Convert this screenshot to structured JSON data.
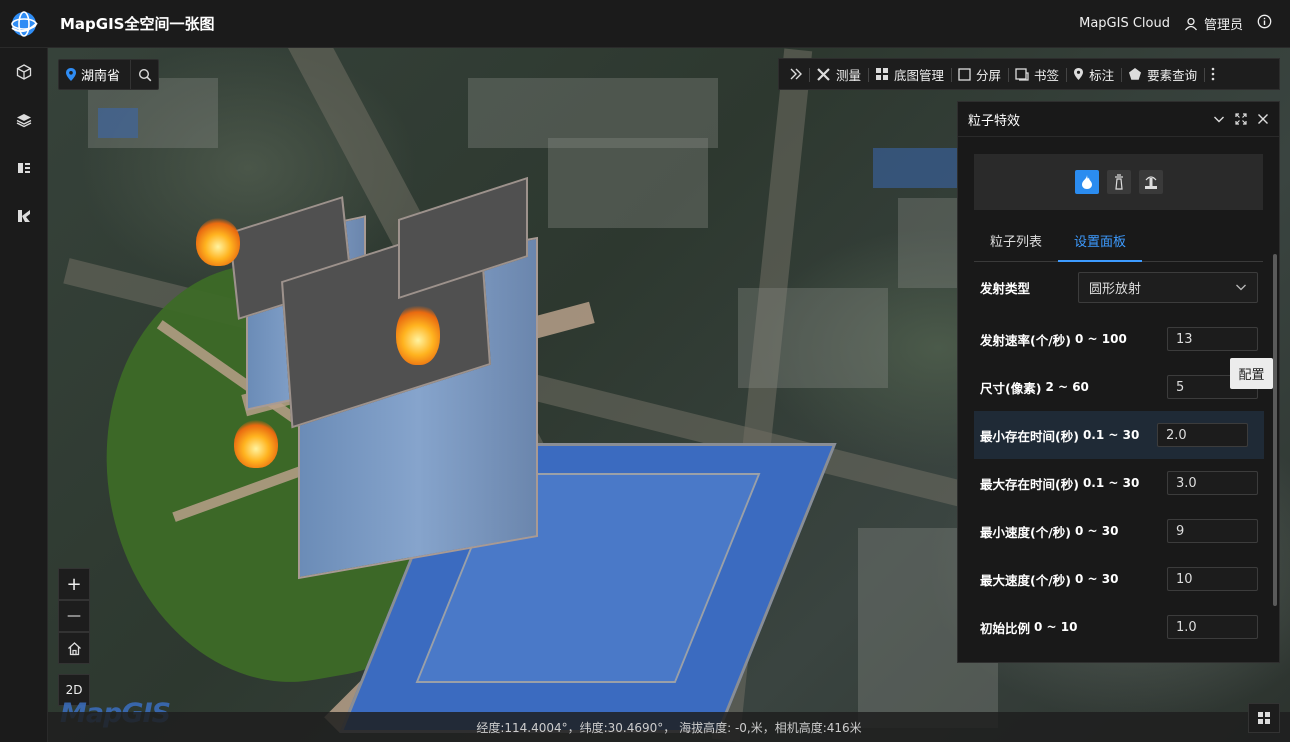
{
  "header": {
    "app_title": "MapGIS全空间一张图",
    "cloud_label": "MapGIS Cloud",
    "user_label": "管理员"
  },
  "map": {
    "region": "湖南省"
  },
  "toolbar": {
    "items": [
      {
        "label": "测量",
        "icon": "measure-icon"
      },
      {
        "label": "底图管理",
        "icon": "grid-icon"
      },
      {
        "label": "分屏",
        "icon": "split-icon"
      },
      {
        "label": "书签",
        "icon": "bookmark-icon"
      },
      {
        "label": "标注",
        "icon": "pin-icon"
      },
      {
        "label": "要素查询",
        "icon": "pentagon-icon"
      }
    ]
  },
  "panel": {
    "title": "粒子特效",
    "tabs": [
      {
        "label": "粒子列表",
        "active": false
      },
      {
        "label": "设置面板",
        "active": true
      }
    ],
    "emit_type_label": "发射类型",
    "emit_type_value": "圆形放射",
    "fields": [
      {
        "label": "发射速率(个/秒)",
        "range": "0 ~ 100",
        "value": "13"
      },
      {
        "label": "尺寸(像素)",
        "range": "2 ~ 60",
        "value": "5"
      },
      {
        "label": "最小存在时间(秒)",
        "range": "0.1 ~ 30",
        "value": "2.0"
      },
      {
        "label": "最大存在时间(秒)",
        "range": "0.1 ~ 30",
        "value": "3.0"
      },
      {
        "label": "最小速度(个/秒)",
        "range": "0 ~ 30",
        "value": "9"
      },
      {
        "label": "最大速度(个/秒)",
        "range": "0 ~ 30",
        "value": "10"
      },
      {
        "label": "初始比例",
        "range": "0 ~ 10",
        "value": "1.0"
      }
    ],
    "tooltip": "配置"
  },
  "controls": {
    "zoom_in": "+",
    "zoom_out": "—",
    "mode_2d": "2D"
  },
  "watermark": "MapGIS",
  "status": {
    "text": "经度:114.4004°，纬度:30.4690°， 海拔高度: -0,米，相机高度:416米"
  },
  "colors": {
    "accent": "#2b8cf0",
    "tab_active": "#3d9bff"
  }
}
